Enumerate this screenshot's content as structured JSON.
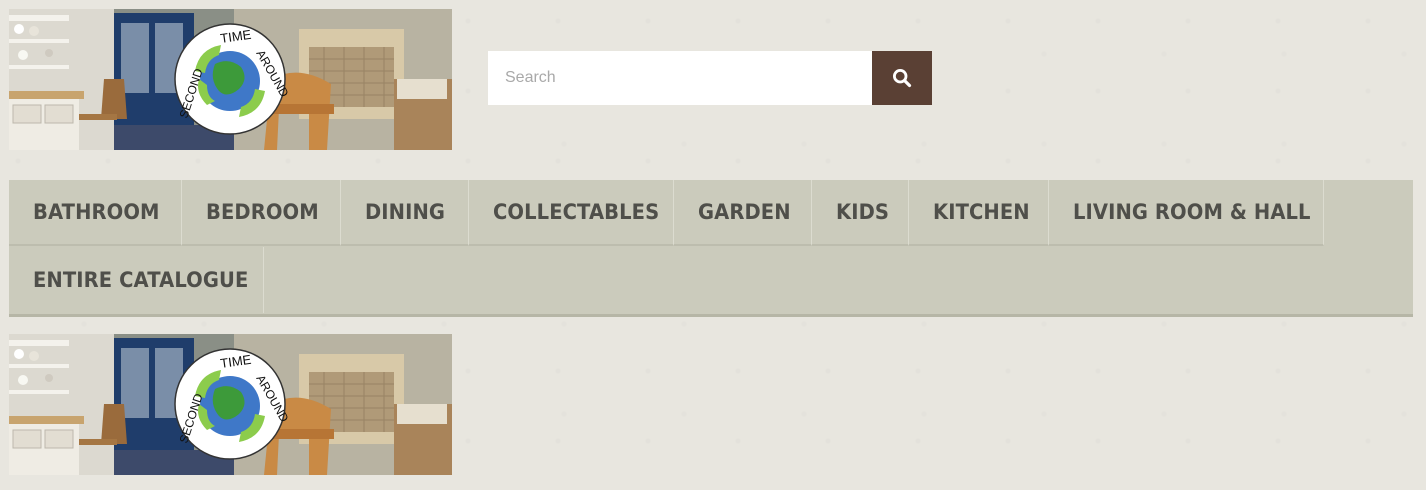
{
  "header": {
    "logo": {
      "name": "second-time-around-logo",
      "text_top": "TIME",
      "text_right": "AROUND",
      "text_left": "SECOND"
    }
  },
  "search": {
    "placeholder": "Search",
    "value": "",
    "button_icon": "search-icon",
    "button_color": "#5a4034"
  },
  "nav": {
    "items": [
      {
        "label": "BATHROOM"
      },
      {
        "label": "BEDROOM"
      },
      {
        "label": "DINING"
      },
      {
        "label": "COLLECTABLES"
      },
      {
        "label": "GARDEN"
      },
      {
        "label": "KIDS"
      },
      {
        "label": "KITCHEN"
      },
      {
        "label": "LIVING ROOM & HALL"
      },
      {
        "label": "ENTIRE CATALOGUE"
      }
    ]
  },
  "colors": {
    "page_background": "#e8e6df",
    "nav_background": "#cbcbbc",
    "nav_text": "#4f4f4a",
    "search_button": "#5a4034"
  }
}
